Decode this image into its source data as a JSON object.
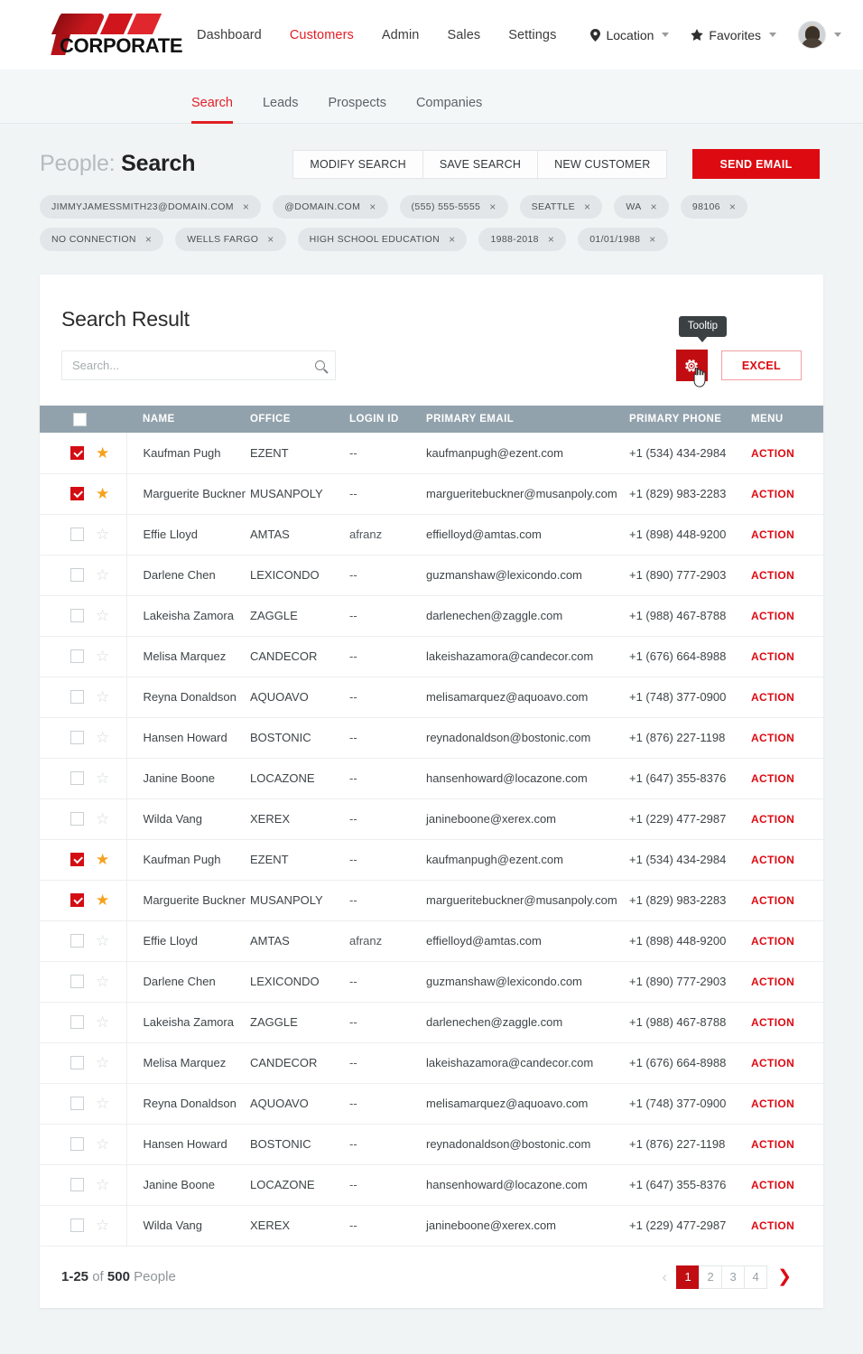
{
  "brand": {
    "name": "CORPORATE"
  },
  "mainnav": [
    {
      "label": "Dashboard",
      "active": false
    },
    {
      "label": "Customers",
      "active": true
    },
    {
      "label": "Admin",
      "active": false
    },
    {
      "label": "Sales",
      "active": false
    },
    {
      "label": "Settings",
      "active": false
    }
  ],
  "headerright": {
    "location": "Location",
    "favorites": "Favorites"
  },
  "subnav": [
    {
      "label": "Search",
      "active": true
    },
    {
      "label": "Leads",
      "active": false
    },
    {
      "label": "Prospects",
      "active": false
    },
    {
      "label": "Companies",
      "active": false
    }
  ],
  "page": {
    "title_prefix": "People:",
    "title_main": "Search",
    "buttons": [
      "MODIFY SEARCH",
      "SAVE SEARCH",
      "NEW CUSTOMER"
    ],
    "primary_button": "SEND EMAIL"
  },
  "chips": [
    "JIMMYJAMESSMITH23@DOMAIN.COM",
    "@DOMAIN.COM",
    "(555) 555-5555",
    "SEATTLE",
    "WA",
    "98106",
    "NO CONNECTION",
    "WELLS FARGO",
    "HIGH SCHOOL EDUCATION",
    "1988-2018",
    "01/01/1988"
  ],
  "chip_close": "×",
  "card": {
    "title": "Search Result",
    "search_placeholder": "Search...",
    "search_value": "",
    "tooltip": "Tooltip",
    "excel_label": "EXCEL"
  },
  "table": {
    "columns": [
      "NAME",
      "OFFICE",
      "LOGIN ID",
      "PRIMARY EMAIL",
      "PRIMARY PHONE",
      "MENU"
    ],
    "action_label": "ACTION",
    "rows": [
      {
        "checked": true,
        "starred": true,
        "name": "Kaufman Pugh",
        "office": "EZENT",
        "login": "--",
        "email": "kaufmanpugh@ezent.com",
        "phone": "+1 (534) 434-2984"
      },
      {
        "checked": true,
        "starred": true,
        "name": "Marguerite Buckner",
        "office": "MUSANPOLY",
        "login": "--",
        "email": "margueritebuckner@musanpoly.com",
        "phone": "+1 (829) 983-2283"
      },
      {
        "checked": false,
        "starred": false,
        "name": "Effie Lloyd",
        "office": "AMTAS",
        "login": "afranz",
        "email": "effielloyd@amtas.com",
        "phone": "+1 (898) 448-9200"
      },
      {
        "checked": false,
        "starred": false,
        "name": "Darlene Chen",
        "office": "LEXICONDO",
        "login": "--",
        "email": "guzmanshaw@lexicondo.com",
        "phone": "+1 (890) 777-2903"
      },
      {
        "checked": false,
        "starred": false,
        "name": "Lakeisha Zamora",
        "office": "ZAGGLE",
        "login": "--",
        "email": "darlenechen@zaggle.com",
        "phone": "+1 (988) 467-8788"
      },
      {
        "checked": false,
        "starred": false,
        "name": "Melisa Marquez",
        "office": "CANDECOR",
        "login": "--",
        "email": "lakeishazamora@candecor.com",
        "phone": "+1 (676) 664-8988"
      },
      {
        "checked": false,
        "starred": false,
        "name": "Reyna Donaldson",
        "office": "AQUOAVO",
        "login": "--",
        "email": "melisamarquez@aquoavo.com",
        "phone": "+1 (748) 377-0900"
      },
      {
        "checked": false,
        "starred": false,
        "name": "Hansen Howard",
        "office": "BOSTONIC",
        "login": "--",
        "email": "reynadonaldson@bostonic.com",
        "phone": "+1 (876) 227-1198"
      },
      {
        "checked": false,
        "starred": false,
        "name": "Janine Boone",
        "office": "LOCAZONE",
        "login": "--",
        "email": "hansenhoward@locazone.com",
        "phone": "+1 (647) 355-8376"
      },
      {
        "checked": false,
        "starred": false,
        "name": "Wilda Vang",
        "office": "XEREX",
        "login": "--",
        "email": "janineboone@xerex.com",
        "phone": "+1 (229) 477-2987"
      },
      {
        "checked": true,
        "starred": true,
        "name": "Kaufman Pugh",
        "office": "EZENT",
        "login": "--",
        "email": "kaufmanpugh@ezent.com",
        "phone": "+1 (534) 434-2984"
      },
      {
        "checked": true,
        "starred": true,
        "name": "Marguerite Buckner",
        "office": "MUSANPOLY",
        "login": "--",
        "email": "margueritebuckner@musanpoly.com",
        "phone": "+1 (829) 983-2283"
      },
      {
        "checked": false,
        "starred": false,
        "name": "Effie Lloyd",
        "office": "AMTAS",
        "login": "afranz",
        "email": "effielloyd@amtas.com",
        "phone": "+1 (898) 448-9200"
      },
      {
        "checked": false,
        "starred": false,
        "name": "Darlene Chen",
        "office": "LEXICONDO",
        "login": "--",
        "email": "guzmanshaw@lexicondo.com",
        "phone": "+1 (890) 777-2903"
      },
      {
        "checked": false,
        "starred": false,
        "name": "Lakeisha Zamora",
        "office": "ZAGGLE",
        "login": "--",
        "email": "darlenechen@zaggle.com",
        "phone": "+1 (988) 467-8788"
      },
      {
        "checked": false,
        "starred": false,
        "name": "Melisa Marquez",
        "office": "CANDECOR",
        "login": "--",
        "email": "lakeishazamora@candecor.com",
        "phone": "+1 (676) 664-8988"
      },
      {
        "checked": false,
        "starred": false,
        "name": "Reyna Donaldson",
        "office": "AQUOAVO",
        "login": "--",
        "email": "melisamarquez@aquoavo.com",
        "phone": "+1 (748) 377-0900"
      },
      {
        "checked": false,
        "starred": false,
        "name": "Hansen Howard",
        "office": "BOSTONIC",
        "login": "--",
        "email": "reynadonaldson@bostonic.com",
        "phone": "+1 (876) 227-1198"
      },
      {
        "checked": false,
        "starred": false,
        "name": "Janine Boone",
        "office": "LOCAZONE",
        "login": "--",
        "email": "hansenhoward@locazone.com",
        "phone": "+1 (647) 355-8376"
      },
      {
        "checked": false,
        "starred": false,
        "name": "Wilda Vang",
        "office": "XEREX",
        "login": "--",
        "email": "janineboone@xerex.com",
        "phone": "+1 (229) 477-2987"
      }
    ]
  },
  "footer": {
    "range": "1-25",
    "of": " of ",
    "total": "500",
    "unit": " People",
    "pages": [
      "1",
      "2",
      "3",
      "4"
    ],
    "active_page": "1",
    "prev_glyph": "‹",
    "next_glyph": "❯"
  },
  "colors": {
    "brand_red": "#dd0a12",
    "dark_red": "#c10d12",
    "table_header": "#92a2ad",
    "star_gold": "#f5a11d",
    "page_bg": "#f1f4f5"
  },
  "icons": {
    "star_filled": "★",
    "star_outline": "☆"
  }
}
